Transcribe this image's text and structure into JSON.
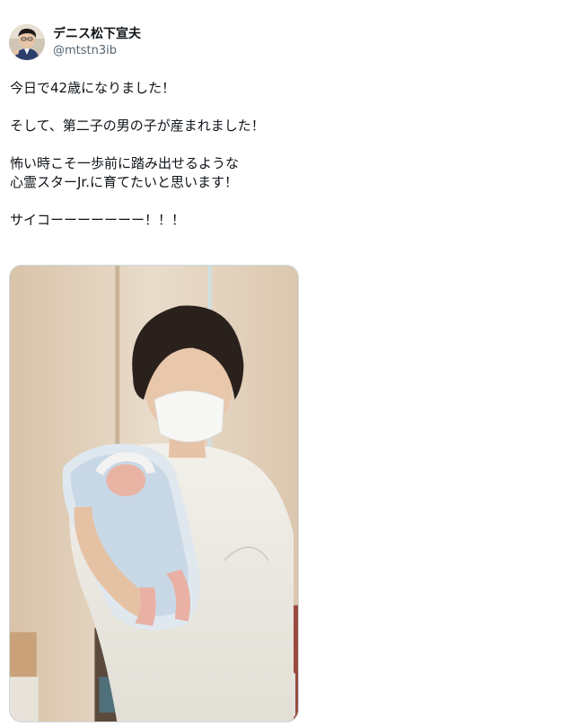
{
  "tweet": {
    "author": {
      "display_name": "デニス松下宣夫",
      "handle": "@mtstn3ib",
      "avatar_icon": "profile-photo-icon"
    },
    "text": {
      "line1": "今日で42歳になりました！",
      "line2": "そして、第二子の男の子が産まれました！",
      "line3a": "怖い時こそ一歩前に踏み出せるような",
      "line3b": "心霊スターJr.に育てたいと思います！",
      "line4": "サイコーーーーーーー！！！"
    },
    "media": {
      "type": "photo",
      "description_icon": "photo-man-holding-newborn-icon"
    }
  },
  "colors": {
    "text_primary": "#0f1419",
    "text_secondary": "#536471",
    "border": "#cfd9de"
  }
}
